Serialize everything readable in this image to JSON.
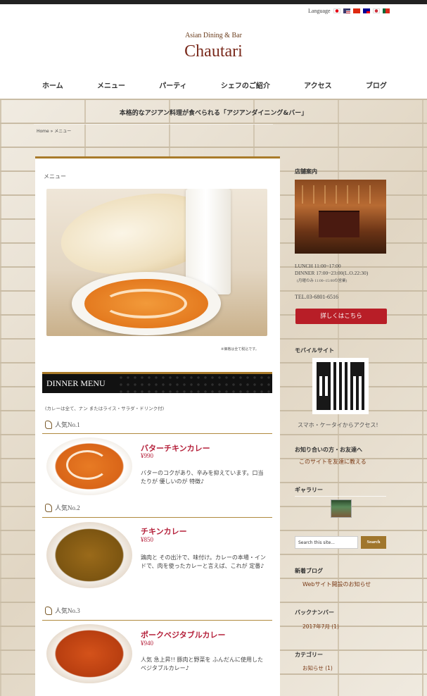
{
  "language": {
    "label": "Language",
    "flags": [
      {
        "icon": "japan-flag-icon",
        "color": "#e60012"
      },
      {
        "icon": "usa-flag-icon",
        "color": "#3c3b6e"
      },
      {
        "icon": "china-flag-icon",
        "color": "#de2910"
      },
      {
        "icon": "taiwan-flag-icon",
        "color": "#fe0000"
      },
      {
        "icon": "korea-flag-icon",
        "color": "#cd2e3a"
      },
      {
        "icon": "portugal-flag-icon",
        "color": "#046a38"
      }
    ]
  },
  "header": {
    "tagline": "Asian Dining & Bar",
    "title": "Chautari"
  },
  "nav": [
    "ホーム",
    "メニュー",
    "パーティ",
    "シェフのご紹介",
    "アクセス",
    "ブログ"
  ],
  "catchcopy": "本格的なアジアン料理が食べられる「アジアンダイニング&バー」",
  "breadcrumb": "Home » メニュー",
  "main": {
    "heading": "メニュー",
    "price_note": "※価格は全て税込です。",
    "dinner_title": "DINNER MENU",
    "dinner_note": "(カレーは全て、ナン またはライス・サラダ・ドリンク付)",
    "items": [
      {
        "rank": "人気No.1",
        "name": "バターチキンカレー",
        "price": "¥990",
        "desc": "バターのコクがあり、辛みを抑えています。口当たりが 優しいのが 特徴♪"
      },
      {
        "rank": "人気No.2",
        "name": "チキンカレー",
        "price": "¥850",
        "desc": "鶏肉と その出汁で、味付け。カレーの本場・インドで、肉を使ったカレーと言えば、これが 定番♪"
      },
      {
        "rank": "人気No.3",
        "name": "ポークベジタブルカレー",
        "price": "¥940",
        "desc": "人気 急上昇!! 豚肉と野菜を ふんだんに使用した ベジタブルカレー♪"
      }
    ]
  },
  "sidebar": {
    "store_heading": "店舗案内",
    "lunch": "LUNCH 11:00~17:00",
    "dinner": "DINNER 17:00~23:00(L.O.22:30)",
    "holiday": "(月曜のみ 11:00~15:00の営業)",
    "tel": "TEL.03-6801-6516",
    "detail_button": "詳しくはこちら",
    "mobile_heading": "モバイルサイト",
    "mobile_text": "スマホ・ケータイからアクセス!",
    "friends_heading": "お知り合いの方・お友達へ",
    "friends_link": "このサイトを友達に教える",
    "gallery_heading": "ギャラリー",
    "search_placeholder": "Search this site...",
    "search_button": "Search",
    "blog_heading": "新着ブログ",
    "blog_link": "Webサイト開設のお知らせ",
    "archive_heading": "バックナンバー",
    "archive_link": "2017年7月 (1)",
    "category_heading": "カテゴリー",
    "category_link": "お知らせ (1)"
  },
  "colors": {
    "accent_red": "#b81e27",
    "gold": "#a97b2a",
    "title": "#7a2a1c"
  }
}
